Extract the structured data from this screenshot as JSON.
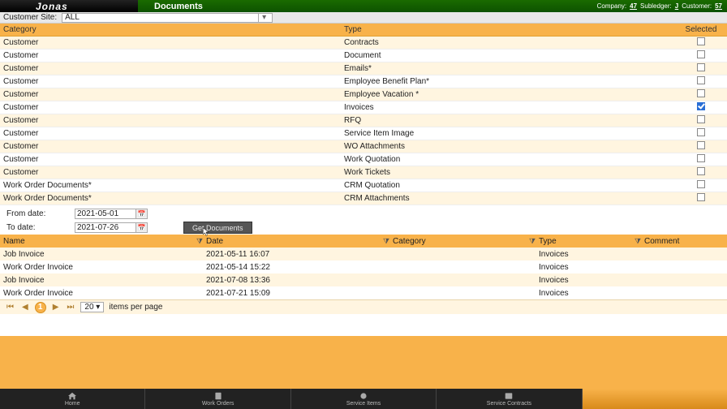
{
  "header": {
    "logo": "Jonas",
    "title": "Documents",
    "company_label": "Company:",
    "company_value": "47",
    "subledger_label": "Subledger:",
    "subledger_value": "J",
    "customer_label": "Customer:",
    "customer_value": "57"
  },
  "customer_site": {
    "label": "Customer Site:",
    "value": "ALL"
  },
  "doc_columns": {
    "category": "Category",
    "type": "Type",
    "selected": "Selected"
  },
  "doc_rows": [
    {
      "category": "Customer",
      "type": "Contracts",
      "selected": false
    },
    {
      "category": "Customer",
      "type": "Document",
      "selected": false
    },
    {
      "category": "Customer",
      "type": "Emails*",
      "selected": false
    },
    {
      "category": "Customer",
      "type": "Employee Benefit Plan*",
      "selected": false
    },
    {
      "category": "Customer",
      "type": "Employee Vacation *",
      "selected": false
    },
    {
      "category": "Customer",
      "type": "Invoices",
      "selected": true
    },
    {
      "category": "Customer",
      "type": "RFQ",
      "selected": false
    },
    {
      "category": "Customer",
      "type": "Service Item Image",
      "selected": false
    },
    {
      "category": "Customer",
      "type": "WO Attachments",
      "selected": false
    },
    {
      "category": "Customer",
      "type": "Work Quotation",
      "selected": false
    },
    {
      "category": "Customer",
      "type": "Work Tickets",
      "selected": false
    },
    {
      "category": "Work Order Documents*",
      "type": "CRM Quotation",
      "selected": false
    },
    {
      "category": "Work Order Documents*",
      "type": "CRM Attachments",
      "selected": false
    }
  ],
  "date": {
    "from_label": "From date:",
    "from_value": "2021-05-01",
    "to_label": "To date:",
    "to_value": "2021-07-26",
    "button": "Get Documents"
  },
  "res_columns": {
    "name": "Name",
    "date": "Date",
    "category": "Category",
    "type": "Type",
    "comment": "Comment"
  },
  "res_rows": [
    {
      "name": "Job Invoice",
      "date": "2021-05-11 16:07",
      "category": "",
      "type": "Invoices",
      "comment": ""
    },
    {
      "name": "Work Order Invoice",
      "date": "2021-05-14 15:22",
      "category": "",
      "type": "Invoices",
      "comment": ""
    },
    {
      "name": "Job Invoice",
      "date": "2021-07-08 13:36",
      "category": "",
      "type": "Invoices",
      "comment": ""
    },
    {
      "name": "Work Order Invoice",
      "date": "2021-07-21 15:09",
      "category": "",
      "type": "Invoices",
      "comment": ""
    }
  ],
  "pager": {
    "page": "1",
    "size": "20",
    "label": "items per page"
  },
  "footer": [
    {
      "label": "Home",
      "icon": "home"
    },
    {
      "label": "Work Orders",
      "icon": "wo"
    },
    {
      "label": "Service Items",
      "icon": "si"
    },
    {
      "label": "Service Contracts",
      "icon": "sc"
    },
    {
      "label": "",
      "icon": ""
    }
  ]
}
